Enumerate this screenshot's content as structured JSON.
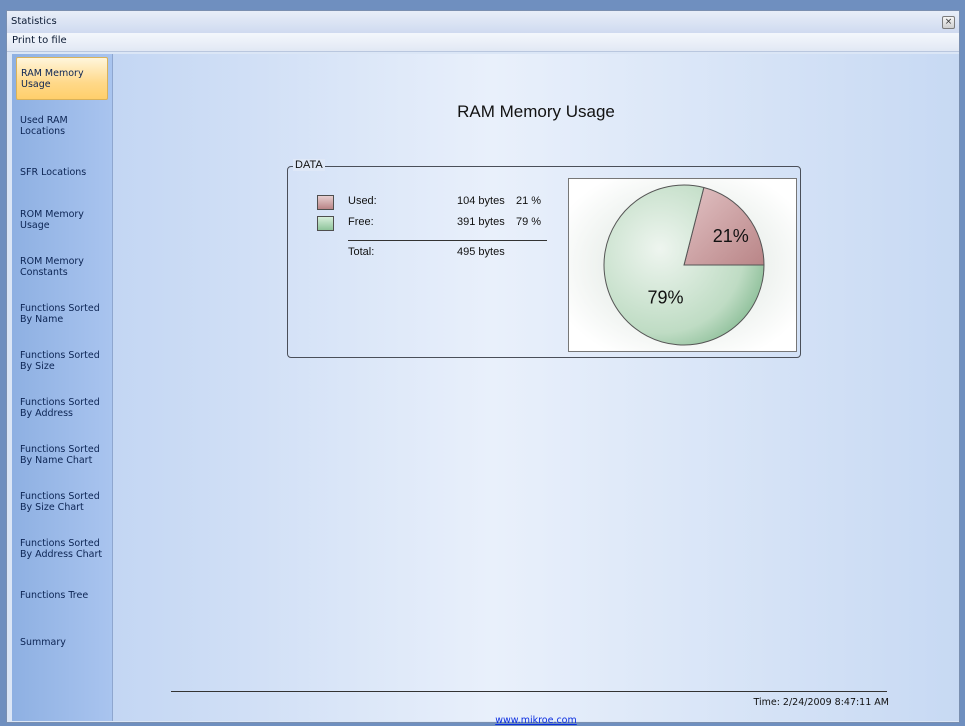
{
  "window": {
    "title": "Statistics",
    "close_glyph": "×"
  },
  "menu": {
    "print_to_file": "Print to file"
  },
  "sidebar": {
    "items": [
      {
        "label": "RAM Memory Usage",
        "active": true
      },
      {
        "label": "Used RAM Locations"
      },
      {
        "label": "SFR Locations"
      },
      {
        "label": "ROM Memory Usage"
      },
      {
        "label": "ROM Memory Constants"
      },
      {
        "label": "Functions Sorted By  Name"
      },
      {
        "label": "Functions Sorted By Size"
      },
      {
        "label": "Functions Sorted By Address"
      },
      {
        "label": "Functions Sorted By Name Chart"
      },
      {
        "label": "Functions Sorted By Size Chart"
      },
      {
        "label": "Functions Sorted By Address Chart"
      },
      {
        "label": "Functions Tree"
      },
      {
        "label": "Summary"
      }
    ]
  },
  "main": {
    "title": "RAM Memory Usage",
    "group_label": "DATA",
    "rows": [
      {
        "label": "Used:",
        "value": "104 bytes",
        "percent": "21 %",
        "color": "#c99a9b"
      },
      {
        "label": "Free:",
        "value": "391 bytes",
        "percent": "79 %",
        "color": "#a7d3b0"
      }
    ],
    "total": {
      "label": "Total:",
      "value": "495 bytes"
    }
  },
  "chart_data": {
    "type": "pie",
    "categories": [
      "Used",
      "Free"
    ],
    "values": [
      104,
      391
    ],
    "labels": [
      "21%",
      "79%"
    ],
    "colors": [
      "#c99a9b",
      "#9fd0a9"
    ]
  },
  "footer": {
    "timestamp": "Time: 2/24/2009 8:47:11 AM",
    "link": "www.mikroe.com"
  }
}
